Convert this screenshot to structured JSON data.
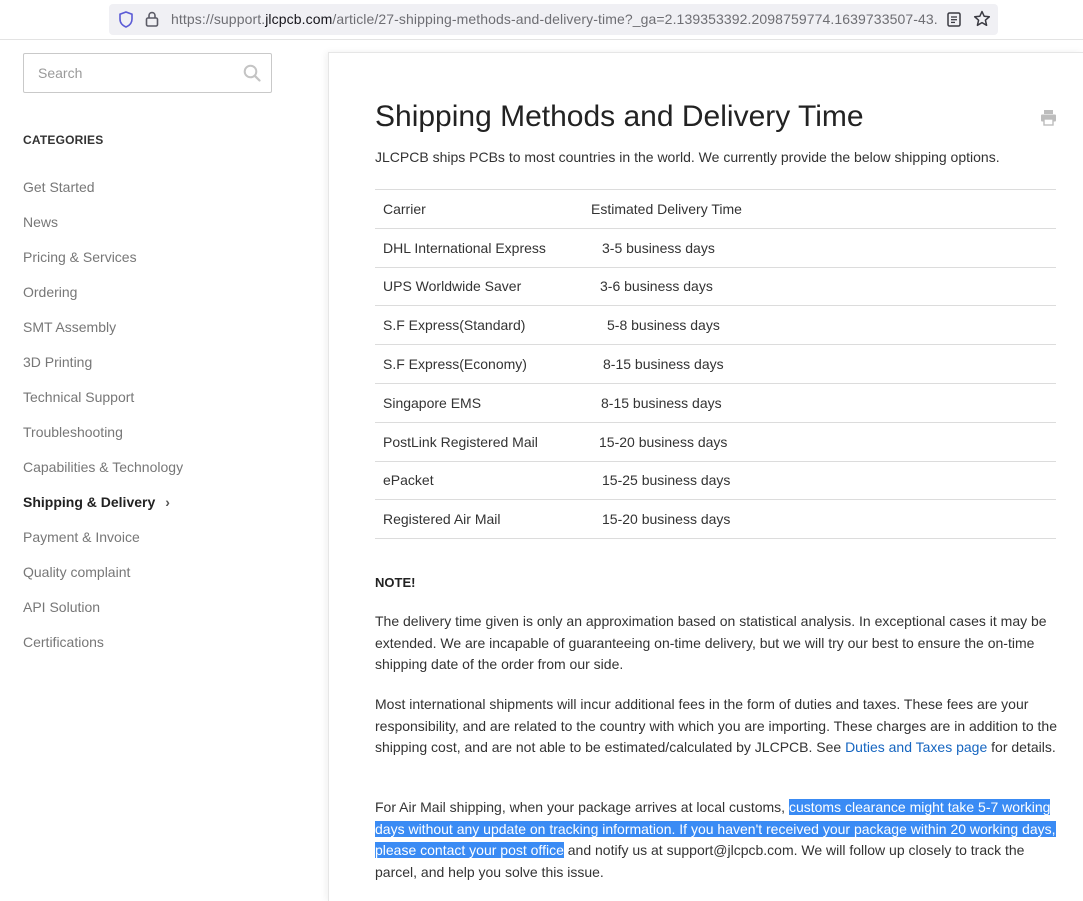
{
  "browser": {
    "url_prefix": "https://support.",
    "url_domain": "jlcpcb.com",
    "url_suffix": "/article/27-shipping-methods-and-delivery-time?_ga=2.139353392.2098759774.1639733507-43..."
  },
  "sidebar": {
    "search_placeholder": "Search",
    "categories_title": "CATEGORIES",
    "items": [
      {
        "label": "Get Started"
      },
      {
        "label": "News"
      },
      {
        "label": "Pricing & Services"
      },
      {
        "label": "Ordering"
      },
      {
        "label": "SMT Assembly"
      },
      {
        "label": "3D Printing"
      },
      {
        "label": "Technical Support"
      },
      {
        "label": "Troubleshooting"
      },
      {
        "label": "Capabilities & Technology"
      },
      {
        "label": "Shipping & Delivery",
        "active": true
      },
      {
        "label": "Payment & Invoice"
      },
      {
        "label": "Quality complaint"
      },
      {
        "label": "API Solution"
      },
      {
        "label": "Certifications"
      }
    ],
    "active_chevron": "›"
  },
  "article": {
    "title": "Shipping Methods and Delivery Time",
    "intro": "JLCPCB ships PCBs to most countries in the world. We currently provide the below shipping options.",
    "table": {
      "header": [
        "Carrier",
        "Estimated Delivery Time"
      ],
      "rows": [
        [
          "DHL International Express",
          "3-5 business days"
        ],
        [
          "UPS Worldwide Saver",
          "3-6 business days"
        ],
        [
          "S.F Express(Standard)",
          "5-8 business days"
        ],
        [
          "S.F Express(Economy)",
          "8-15 business days"
        ],
        [
          "Singapore EMS",
          "8-15 business days"
        ],
        [
          "PostLink Registered Mail",
          "15-20 business days"
        ],
        [
          "ePacket",
          "15-25 business days"
        ],
        [
          "Registered Air Mail",
          "15-20 business days"
        ]
      ]
    },
    "note_heading": "NOTE!",
    "paragraph1": "The delivery time given is only an approximation based on statistical analysis. In exceptional cases it may be extended. We are incapable of guaranteeing on-time delivery, but we will try our best to ensure the on-time shipping date of the order from our side.",
    "paragraph2_before": "Most international shipments will incur additional fees in the form of duties and taxes. These fees are your responsibility, and are related to the country with which you are importing. These charges are in addition to the shipping cost, and are not able to be estimated/calculated by JLCPCB. See ",
    "paragraph2_link": "Duties and Taxes page",
    "paragraph2_after": " for details.",
    "paragraph3_before": "For Air Mail shipping, when your package arrives at local customs, ",
    "paragraph3_highlight": "customs clearance might take 5-7 working days without any update on tracking information. If you haven't received your package within 20 working days, please contact your post office",
    "paragraph3_after": " and notify us at support@jlcpcb.com. We will follow up closely to track the parcel, and help you solve this issue."
  },
  "colors": {
    "link": "#1565c0",
    "selection_highlight": "#3a8bf4"
  }
}
